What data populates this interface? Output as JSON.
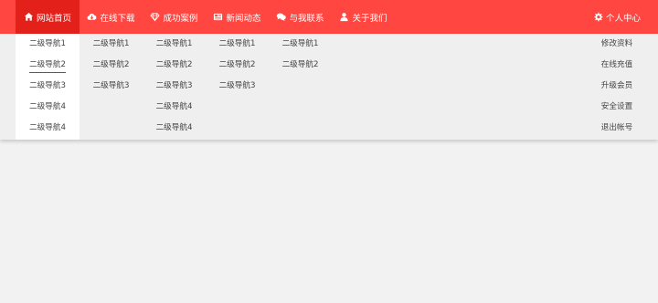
{
  "nav": {
    "items": [
      {
        "label": "网站首页",
        "icon": "home-icon"
      },
      {
        "label": "在线下载",
        "icon": "cloud-download-icon"
      },
      {
        "label": "成功案例",
        "icon": "diamond-icon"
      },
      {
        "label": "新闻动态",
        "icon": "newspaper-icon"
      },
      {
        "label": "与我联系",
        "icon": "comments-icon"
      },
      {
        "label": "关于我们",
        "icon": "user-icon"
      }
    ],
    "user": {
      "label": "个人中心",
      "icon": "gear-icon"
    },
    "active_color": "#e4201b",
    "bar_color": "#ff4641"
  },
  "dropdown": {
    "columns": [
      [
        "二级导航1",
        "二级导航2",
        "二级导航3",
        "二级导航4",
        "二级导航4"
      ],
      [
        "二级导航1",
        "二级导航2",
        "二级导航3"
      ],
      [
        "二级导航1",
        "二级导航2",
        "二级导航3",
        "二级导航4",
        "二级导航4"
      ],
      [
        "二级导航1",
        "二级导航2",
        "二级导航3"
      ],
      [
        "二级导航1",
        "二级导航2"
      ]
    ],
    "user_menu": [
      "修改资料",
      "在线充值",
      "升级会员",
      "安全设置",
      "退出帐号"
    ]
  }
}
